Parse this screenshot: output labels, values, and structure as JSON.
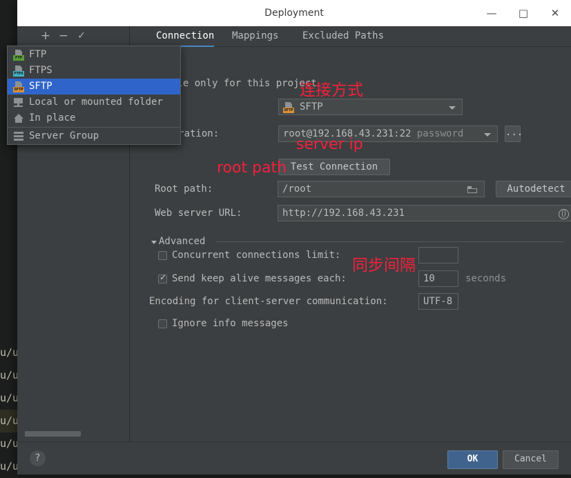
{
  "window": {
    "title": "Deployment",
    "minimize_label": "—",
    "maximize_label": "□",
    "close_label": "✕"
  },
  "left_toolbar": {
    "add_label": "+",
    "remove_label": "−",
    "check_label": "✓"
  },
  "type_menu": {
    "items": [
      {
        "label": "FTP",
        "icon": "ftp-server-icon",
        "badge": "FTP",
        "badge_color": "#5a9e3a",
        "selected": false
      },
      {
        "label": "FTPS",
        "icon": "ftps-server-icon",
        "badge": "FTPS",
        "badge_color": "#3fb6c9",
        "selected": false
      },
      {
        "label": "SFTP",
        "icon": "sftp-server-icon",
        "badge": "SFTP",
        "badge_color": "#d7923a",
        "selected": true
      },
      {
        "label": "Local or mounted folder",
        "icon": "mounted-folder-icon",
        "badge": "",
        "badge_color": "",
        "selected": false
      },
      {
        "label": "In place",
        "icon": "home-icon",
        "badge": "",
        "badge_color": "",
        "selected": false
      },
      {
        "label": "Server Group",
        "icon": "server-group-icon",
        "badge": "",
        "badge_color": "",
        "selected": false
      }
    ]
  },
  "tabs": [
    {
      "label": "Connection",
      "active": true
    },
    {
      "label": "Mappings",
      "active": false
    },
    {
      "label": "Excluded Paths",
      "active": false
    }
  ],
  "form": {
    "visible_only_label": "ble only for this project",
    "type_combo_value": "SFTP",
    "type_combo_icon": "sftp-server-icon",
    "ssh_config_label": "nfiguration:",
    "ssh_config_value": "root@192.168.43.231:22",
    "ssh_config_auth": "password",
    "ssh_browse_label": "...",
    "test_connection_label": "Test Connection",
    "root_path_label": "Root path:",
    "root_path_value": "/root",
    "autodetect_label": "Autodetect",
    "web_url_label": "Web server URL:",
    "web_url_value": "http://192.168.43.231"
  },
  "advanced": {
    "section_label": "Advanced",
    "concurrent_label": "Concurrent connections limit:",
    "concurrent_checked": false,
    "concurrent_value": "",
    "keepalive_label": "Send keep alive messages each:",
    "keepalive_checked": true,
    "keepalive_value": "10",
    "keepalive_units": "seconds",
    "encoding_label": "Encoding for client-server communication:",
    "encoding_value": "UTF-8",
    "ignore_info_label": "Ignore info messages",
    "ignore_info_checked": false
  },
  "annotations": [
    {
      "text": "连接方式",
      "meaning": "connection-type"
    },
    {
      "text": "server ip",
      "meaning": "server-ip"
    },
    {
      "text": "root path",
      "meaning": "root-path"
    },
    {
      "text": "同步间隔",
      "meaning": "sync-interval"
    }
  ],
  "footer": {
    "help_label": "?",
    "ok_label": "OK",
    "cancel_label": "Cancel"
  },
  "background": {
    "code_fragment": "u/u"
  },
  "colors": {
    "dialog_bg": "#3c3f41",
    "accent_blue": "#2f65ca",
    "tab_underline": "#4a88c7",
    "annotation_red": "#f3203c",
    "ok_button": "#3f638c"
  }
}
